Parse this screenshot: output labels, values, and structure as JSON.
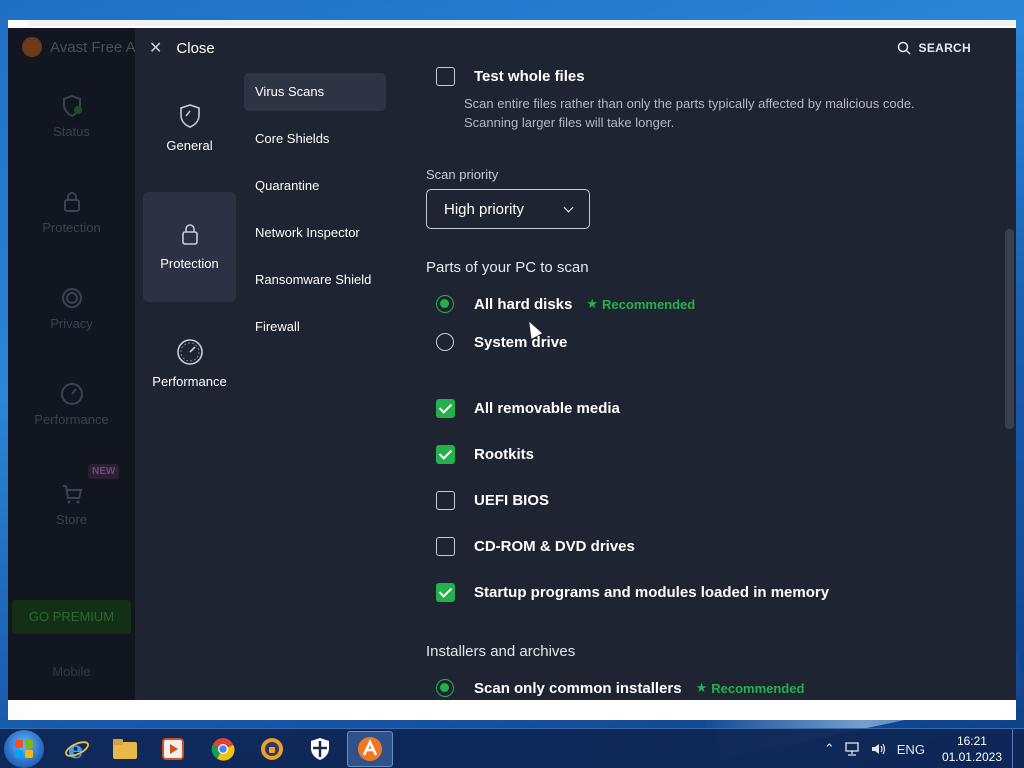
{
  "colors": {
    "accent": "#22b24c",
    "panel_bg": "#1f2433",
    "sidebar_bg": "#121620"
  },
  "bg_app": {
    "logo_text": "Avast Free A",
    "nav": [
      {
        "label": "Status",
        "icon": "shield-icon"
      },
      {
        "label": "Protection",
        "icon": "lock-icon"
      },
      {
        "label": "Privacy",
        "icon": "fingerprint-icon"
      },
      {
        "label": "Performance",
        "icon": "speedometer-icon"
      },
      {
        "label": "Store",
        "icon": "cart-icon"
      }
    ],
    "new_badge": "NEW",
    "premium_label": "GO PREMIUM",
    "mobile_label": "Mobile"
  },
  "settings": {
    "close_label": "Close",
    "search_label": "SEARCH",
    "categories": [
      {
        "label": "General",
        "icon": "shield-outline-icon"
      },
      {
        "label": "Protection",
        "icon": "lock-icon"
      },
      {
        "label": "Performance",
        "icon": "speedometer-icon"
      }
    ],
    "subnav": [
      "Virus Scans",
      "Core Shields",
      "Quarantine",
      "Network Inspector",
      "Ransomware Shield",
      "Firewall"
    ],
    "test_whole_files": {
      "label": "Test whole files",
      "desc1": "Scan entire files rather than only the parts typically affected by malicious code.",
      "desc2": "Scanning larger files will take longer.",
      "checked": false
    },
    "scan_priority_label": "Scan priority",
    "scan_priority_value": "High priority",
    "parts_title": "Parts of your PC to scan",
    "radio_all_disks": "All hard disks",
    "recommended": "Recommended",
    "radio_system_drive": "System drive",
    "checks": [
      {
        "label": "All removable media",
        "checked": true
      },
      {
        "label": "Rootkits",
        "checked": true
      },
      {
        "label": "UEFI BIOS",
        "checked": false
      },
      {
        "label": "CD-ROM & DVD drives",
        "checked": false
      },
      {
        "label": "Startup programs and modules loaded in memory",
        "checked": true
      }
    ],
    "installers_title": "Installers and archives",
    "radio_common_installers": "Scan only common installers"
  },
  "taskbar": {
    "apps": [
      "internet-explorer-icon",
      "explorer-folder-icon",
      "media-player-icon",
      "chrome-icon",
      "browser-shield-icon",
      "security-shield-icon",
      "avast-icon"
    ],
    "language": "ENG",
    "time": "16:21",
    "date": "01.01.2023"
  }
}
